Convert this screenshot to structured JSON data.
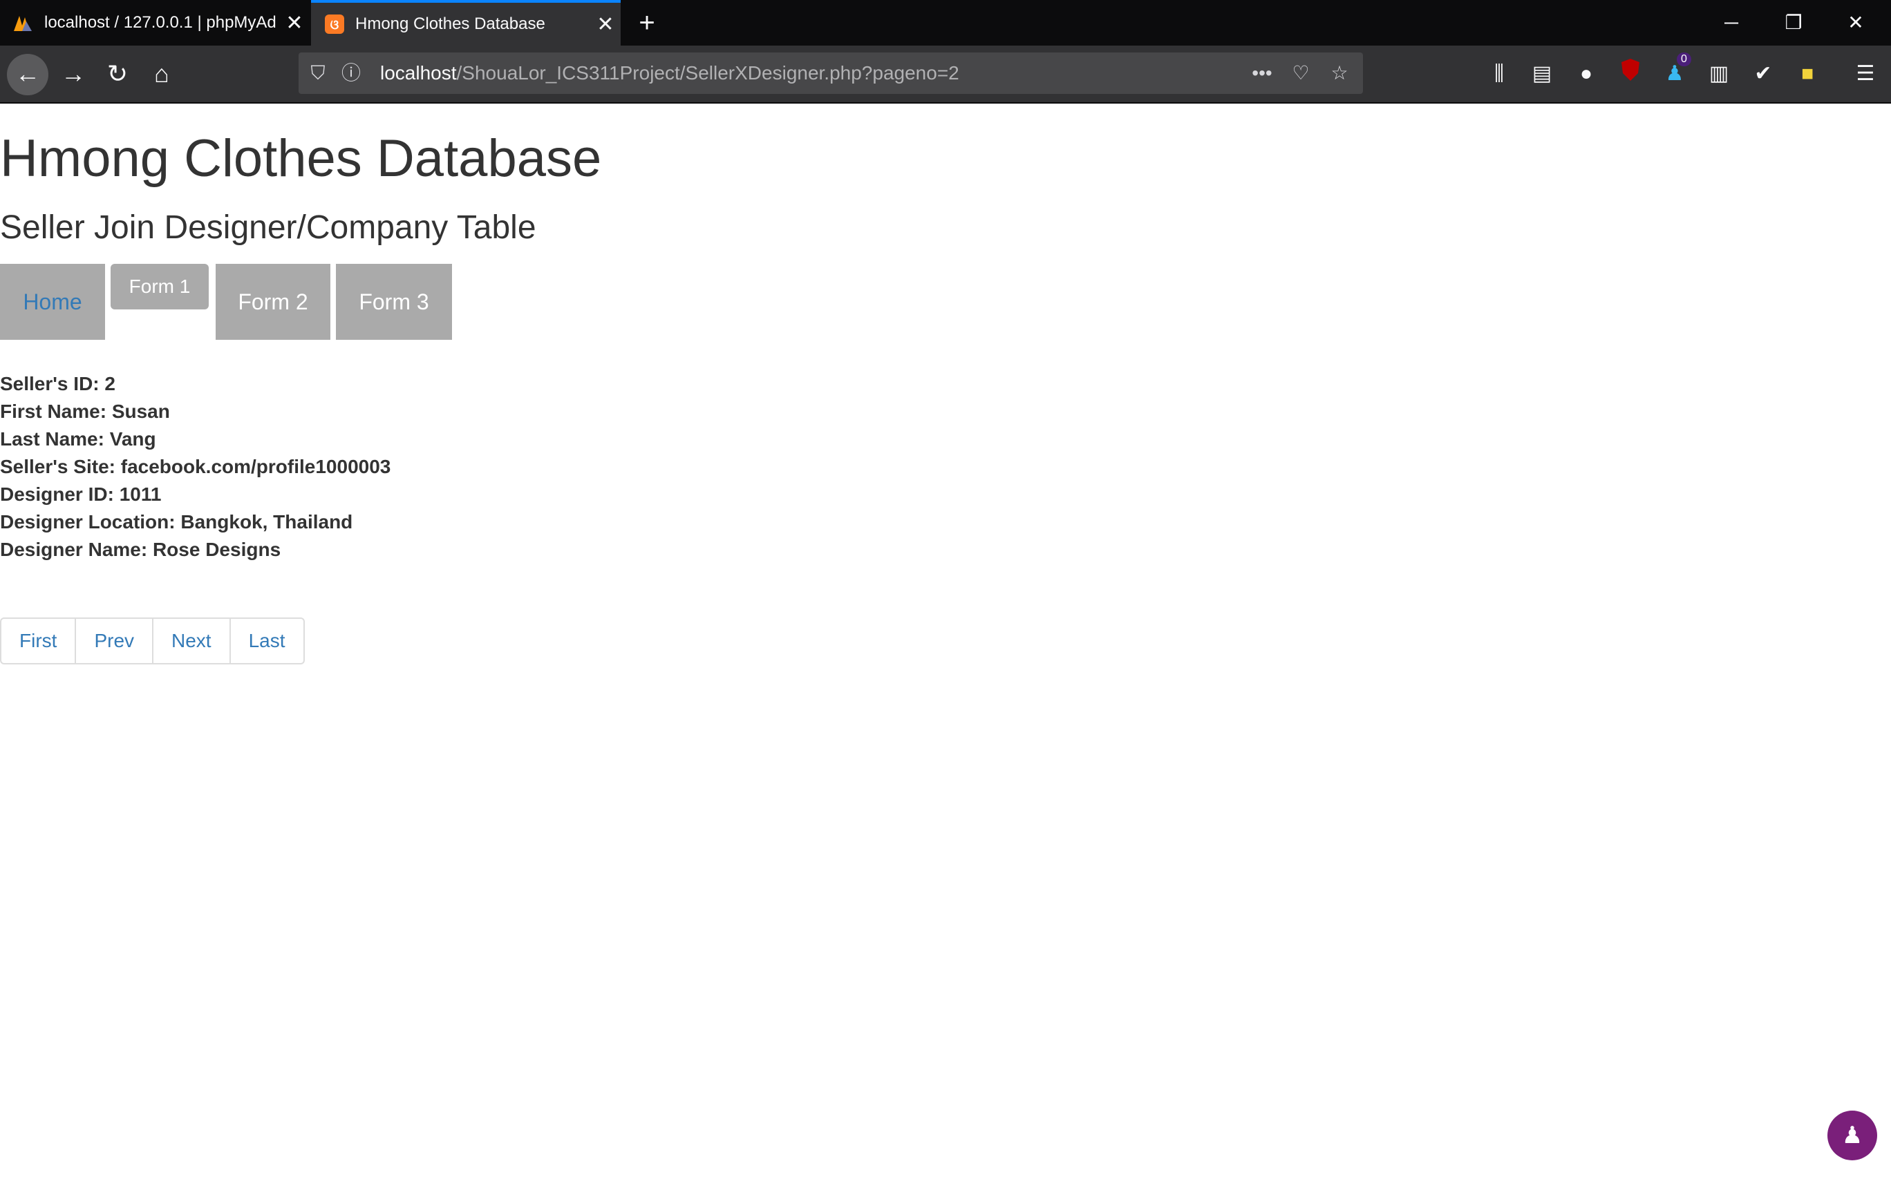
{
  "browser": {
    "tabs": [
      {
        "title": "localhost / 127.0.0.1 | phpMyAd",
        "favicon": "phpmyadmin-icon",
        "active": false
      },
      {
        "title": "Hmong Clothes Database",
        "favicon": "xampp-icon",
        "active": true
      }
    ],
    "close_glyph": "✕",
    "new_tab_glyph": "+",
    "url": {
      "host": "localhost",
      "path": "/ShouaLor_ICS311Project/SellerXDesigner.php?pageno=2"
    },
    "extension_badge": "0"
  },
  "page": {
    "title": "Hmong Clothes Database",
    "subtitle": "Seller Join Designer/Company Table",
    "menu": {
      "home": "Home",
      "form1": "Form 1",
      "form2": "Form 2",
      "form3": "Form 3"
    },
    "record": {
      "seller_id": "Seller's ID: 2",
      "first_name": "First Name: Susan",
      "last_name": "Last Name: Vang",
      "seller_site": "Seller's Site: facebook.com/profile1000003",
      "designer_id": "Designer ID: 1011",
      "designer_location": "Designer Location: Bangkok, Thailand",
      "designer_name": "Designer Name: Rose Designs"
    },
    "pagination": {
      "first": "First",
      "prev": "Prev",
      "next": "Next",
      "last": "Last"
    }
  },
  "colors": {
    "link": "#337ab7",
    "menu_bg": "#aaaaaa",
    "text": "#333333",
    "tab_accent": "#0a84ff"
  }
}
